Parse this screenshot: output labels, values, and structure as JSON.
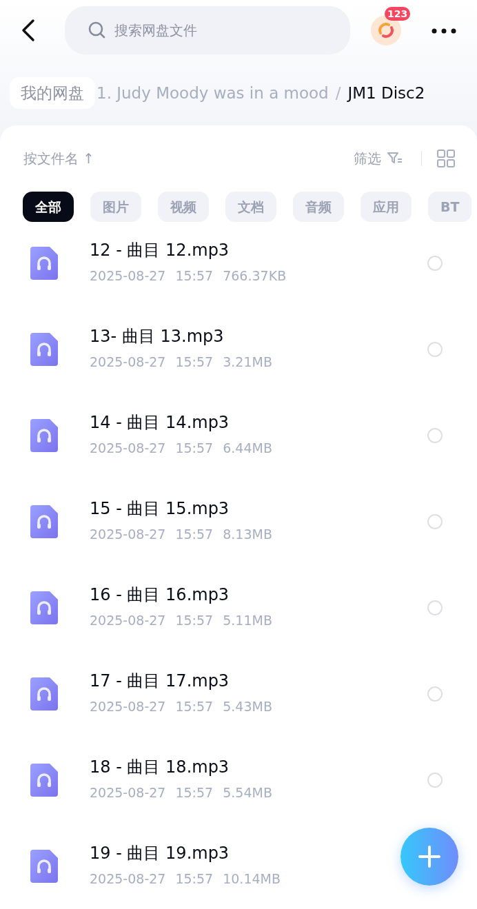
{
  "search": {
    "placeholder": "搜索网盘文件"
  },
  "sync_badge": "123",
  "breadcrumb": {
    "root": "我的网盘",
    "parent": "1. Judy Moody was in a mood",
    "separator": "/",
    "current": "JM1 Disc2"
  },
  "sort": {
    "label": "按文件名",
    "arrow": "↑"
  },
  "filter": {
    "label": "筛选"
  },
  "categories": [
    {
      "label": "全部",
      "selected": true
    },
    {
      "label": "图片",
      "selected": false
    },
    {
      "label": "视频",
      "selected": false
    },
    {
      "label": "文档",
      "selected": false
    },
    {
      "label": "音频",
      "selected": false
    },
    {
      "label": "应用",
      "selected": false
    },
    {
      "label": "BT",
      "selected": false
    }
  ],
  "files": [
    {
      "name": "12 - 曲目 12.mp3",
      "date": "2025-08-27",
      "time": "15:57",
      "size": "766.37KB",
      "selected": false
    },
    {
      "name": "13- 曲目 13.mp3",
      "date": "2025-08-27",
      "time": "15:57",
      "size": "3.21MB",
      "selected": false
    },
    {
      "name": "14 - 曲目 14.mp3",
      "date": "2025-08-27",
      "time": "15:57",
      "size": "6.44MB",
      "selected": false
    },
    {
      "name": "15 - 曲目 15.mp3",
      "date": "2025-08-27",
      "time": "15:57",
      "size": "8.13MB",
      "selected": false
    },
    {
      "name": "16 - 曲目 16.mp3",
      "date": "2025-08-27",
      "time": "15:57",
      "size": "5.11MB",
      "selected": false
    },
    {
      "name": "17 - 曲目 17.mp3",
      "date": "2025-08-27",
      "time": "15:57",
      "size": "5.43MB",
      "selected": false
    },
    {
      "name": "18 - 曲目 18.mp3",
      "date": "2025-08-27",
      "time": "15:57",
      "size": "5.54MB",
      "selected": false
    },
    {
      "name": "19 - 曲目 19.mp3",
      "date": "2025-08-27",
      "time": "15:57",
      "size": "10.14MB"
    }
  ]
}
